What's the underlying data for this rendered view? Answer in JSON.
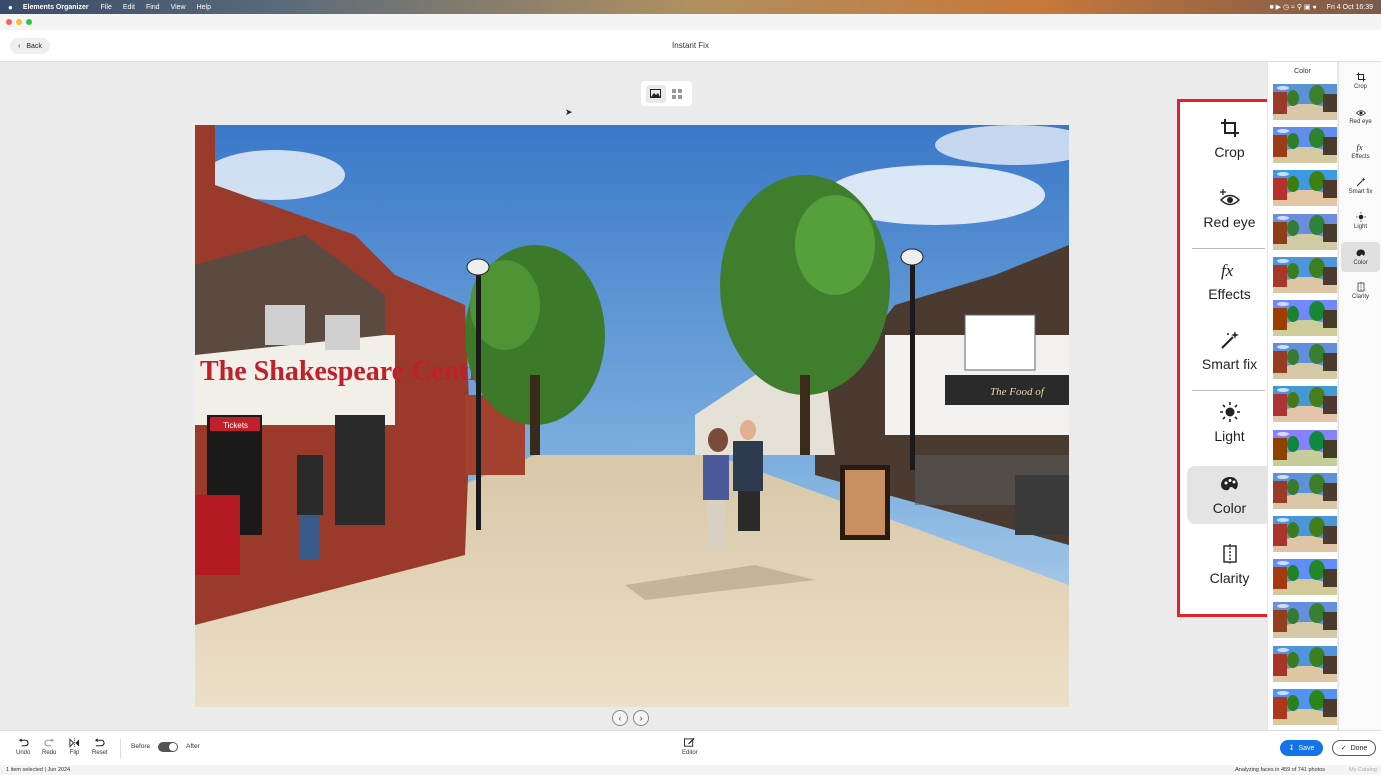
{
  "menubar": {
    "app": "Elements Organizer",
    "items": [
      "File",
      "Edit",
      "Find",
      "View",
      "Help"
    ],
    "clock": "Fri 4 Oct  16:39"
  },
  "header": {
    "back_label": "Back",
    "title": "Instant Fix"
  },
  "tools": [
    {
      "label": "Crop",
      "icon": "crop-icon"
    },
    {
      "label": "Red eye",
      "icon": "red-eye-icon"
    },
    {
      "label": "Effects",
      "icon": "effects-icon"
    },
    {
      "label": "Smart fix",
      "icon": "smart-fix-icon"
    },
    {
      "label": "Light",
      "icon": "light-icon"
    },
    {
      "label": "Color",
      "icon": "color-icon",
      "active": true
    },
    {
      "label": "Clarity",
      "icon": "clarity-icon"
    }
  ],
  "strip": {
    "title": "Color",
    "thumb_count": 15
  },
  "photo": {
    "shop_sign": "The Shakespeare Centre",
    "tickets_sign": "Tickets",
    "right_sign": "The Food of"
  },
  "bottombar": {
    "undo": "Undo",
    "redo": "Redo",
    "flip": "Flip",
    "reset": "Reset",
    "before": "Before",
    "after": "After",
    "editor": "Editor",
    "save": "Save",
    "done": "Done"
  },
  "status": {
    "left": "1 item selected  |  Jun 2024",
    "right": "Analyzing faces in 459 of 741 photos",
    "catalog": "My Catalog"
  },
  "colors": {
    "accent": "#1473e6",
    "highlight": "#e8202a"
  }
}
